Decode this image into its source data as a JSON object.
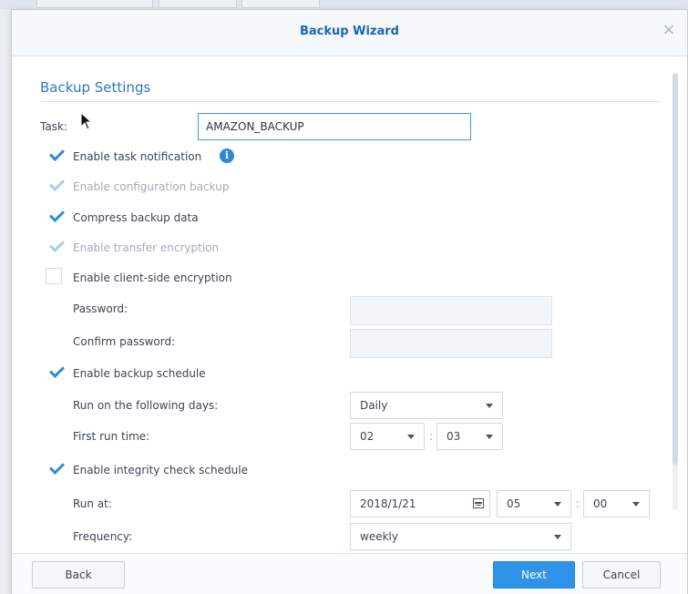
{
  "dialog": {
    "title": "Backup Wizard",
    "close_glyph": "×"
  },
  "section": {
    "title": "Backup Settings"
  },
  "task": {
    "label": "Task:",
    "value": "AMAZON_BACKUP"
  },
  "options": {
    "task_notification": {
      "label": "Enable task notification",
      "checked": true,
      "info_glyph": "i"
    },
    "config_backup": {
      "label": "Enable configuration backup",
      "checked": true,
      "disabled": true
    },
    "compress": {
      "label": "Compress backup data",
      "checked": true
    },
    "transfer_encryption": {
      "label": "Enable transfer encryption",
      "checked": true,
      "disabled": true
    },
    "client_encryption": {
      "label": "Enable client-side encryption",
      "checked": false
    }
  },
  "password": {
    "label": "Password:"
  },
  "confirm_password": {
    "label": "Confirm password:"
  },
  "backup_schedule": {
    "label": "Enable backup schedule",
    "checked": true,
    "days_label": "Run on the following days:",
    "days_value": "Daily",
    "first_run_label": "First run time:",
    "hour": "02",
    "minute": "03",
    "separator": ":"
  },
  "integrity_schedule": {
    "label": "Enable integrity check schedule",
    "checked": true,
    "run_at_label": "Run at:",
    "date": "2018/1/21",
    "hour": "05",
    "minute": "00",
    "separator": ":",
    "frequency_label": "Frequency:",
    "frequency_value": "weekly"
  },
  "footer": {
    "back_label": "Back",
    "next_label": "Next",
    "cancel_label": "Cancel"
  },
  "colors": {
    "accent": "#2f94e8",
    "title": "#1c64b4",
    "checkmark": "#2a8ed8"
  }
}
